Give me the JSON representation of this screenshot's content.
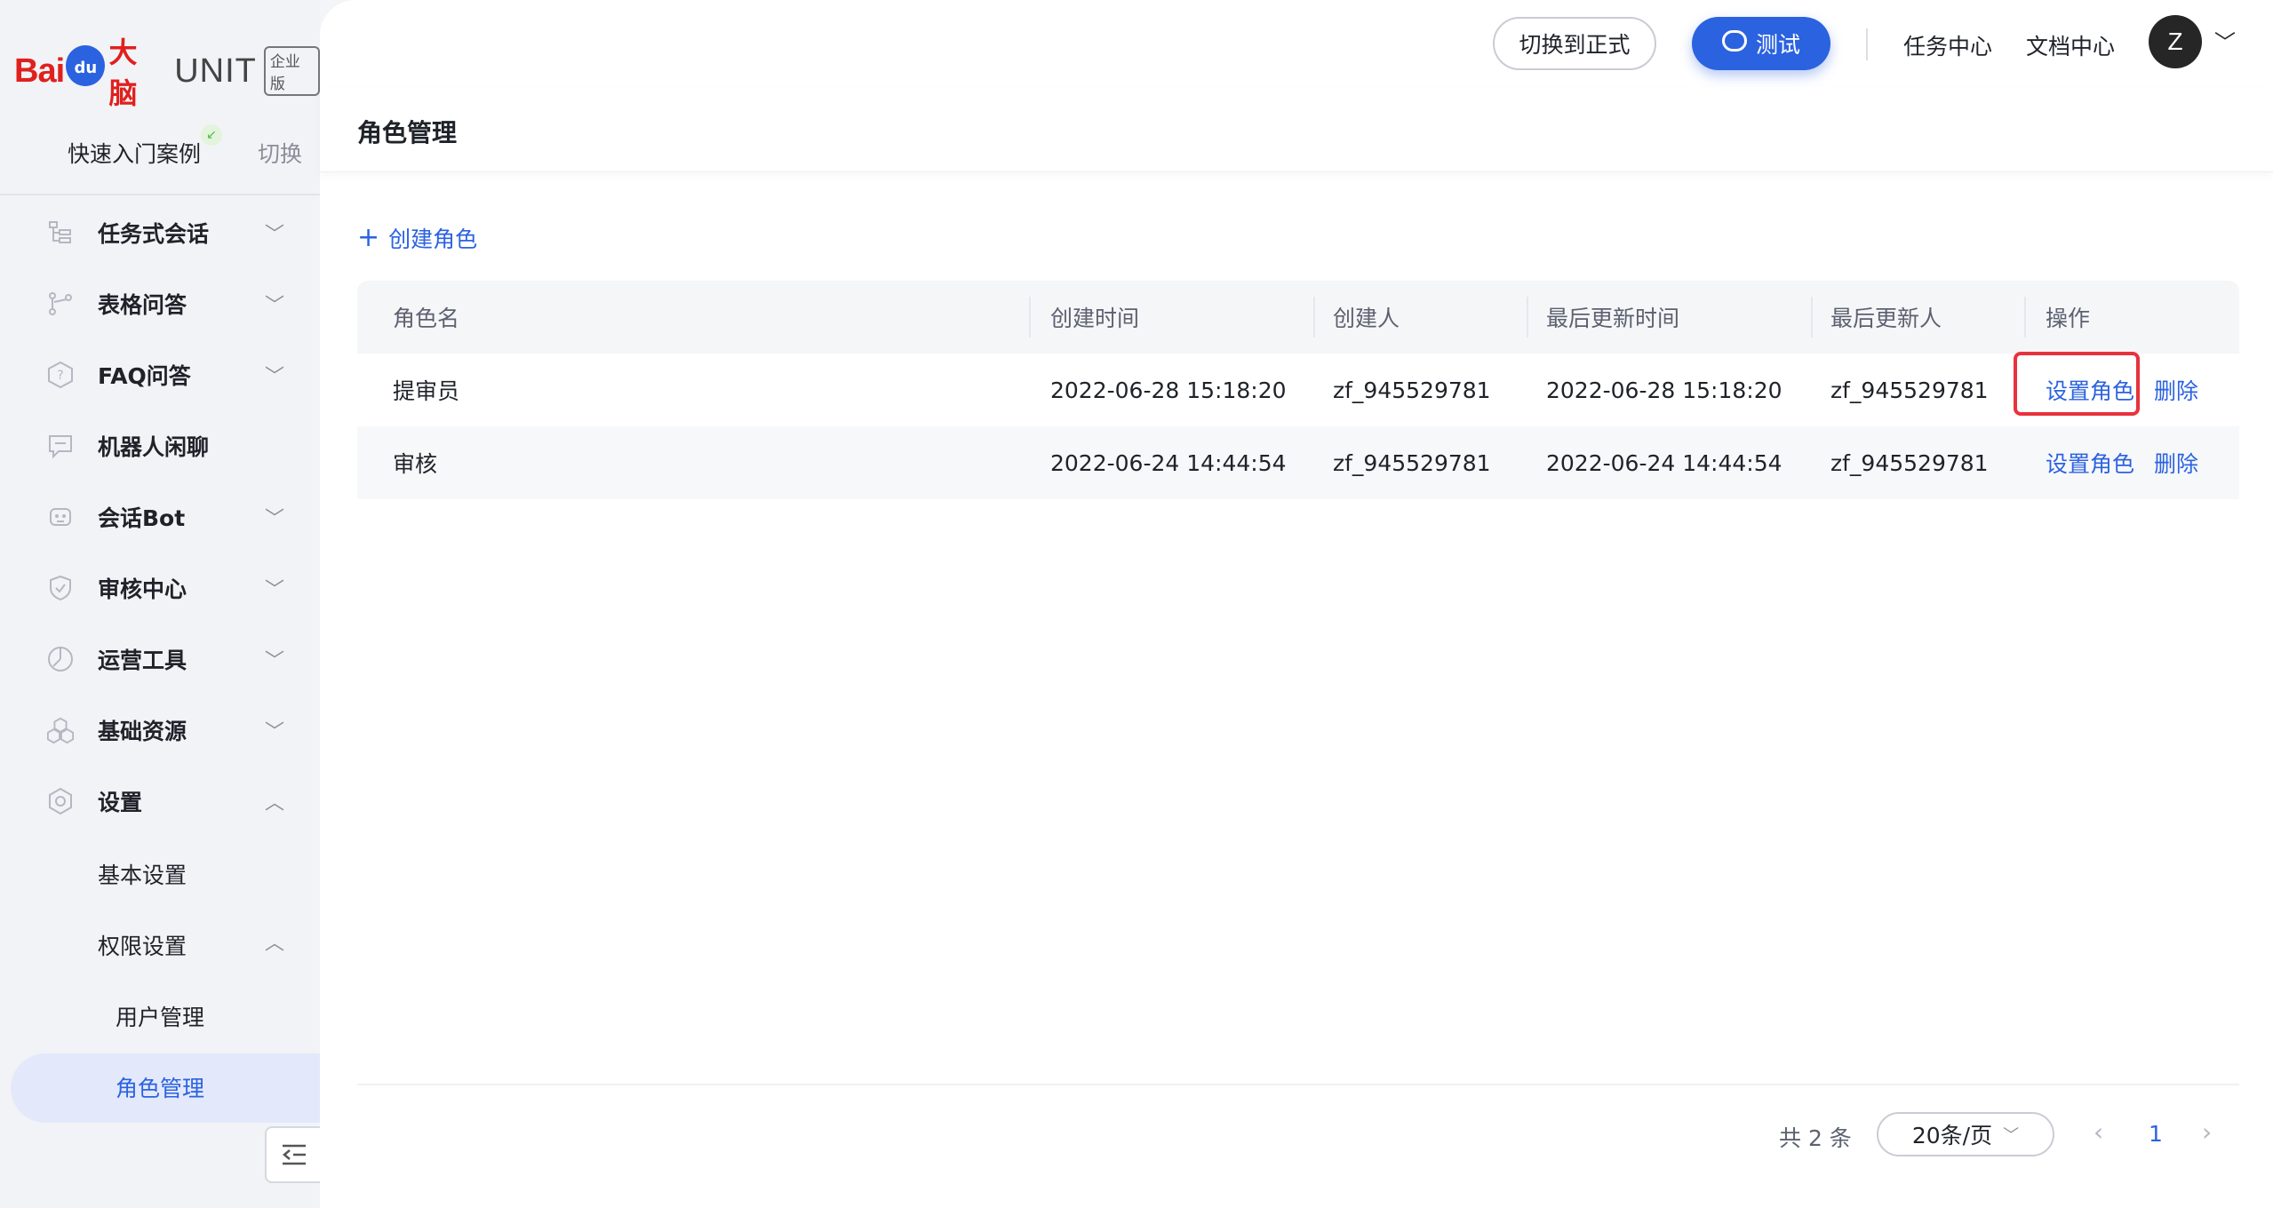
{
  "logo": {
    "bai": "Bai",
    "du": "du",
    "dn": "大脑",
    "unit": "UNIT",
    "badge": "企业版"
  },
  "project": {
    "name": "快速入门案例",
    "switch_label": "切换"
  },
  "sidebar": {
    "items": [
      {
        "label": "任务式会话"
      },
      {
        "label": "表格问答"
      },
      {
        "label": "FAQ问答"
      },
      {
        "label": "机器人闲聊"
      },
      {
        "label": "会话Bot"
      },
      {
        "label": "审核中心"
      },
      {
        "label": "运营工具"
      },
      {
        "label": "基础资源"
      },
      {
        "label": "设置"
      }
    ],
    "sub": {
      "basic": "基本设置",
      "perm": "权限设置",
      "users": "用户管理",
      "roles": "角色管理"
    }
  },
  "topbar": {
    "switch_label": "切换到正式",
    "test_label": "测试",
    "task_center": "任务中心",
    "doc_center": "文档中心",
    "avatar": "Z"
  },
  "page": {
    "title": "角色管理",
    "create_label": "创建角色"
  },
  "table": {
    "headers": [
      "角色名",
      "创建时间",
      "创建人",
      "最后更新时间",
      "最后更新人",
      "操作"
    ],
    "rows": [
      {
        "name": "提审员",
        "created": "2022-06-28 15:18:20",
        "creator": "zf_945529781",
        "updated": "2022-06-28 15:18:20",
        "updater": "zf_945529781",
        "action_set": "设置角色",
        "action_delete": "删除"
      },
      {
        "name": "审核",
        "created": "2022-06-24 14:44:54",
        "creator": "zf_945529781",
        "updated": "2022-06-24 14:44:54",
        "updater": "zf_945529781",
        "action_set": "设置角色",
        "action_delete": "删除"
      }
    ]
  },
  "pagination": {
    "total": "共 2 条",
    "page_size": "20条/页",
    "current": "1"
  },
  "colors": {
    "accent": "#2b62e0",
    "highlight": "#e8323c",
    "sidebar_bg": "#f2f3f7"
  }
}
